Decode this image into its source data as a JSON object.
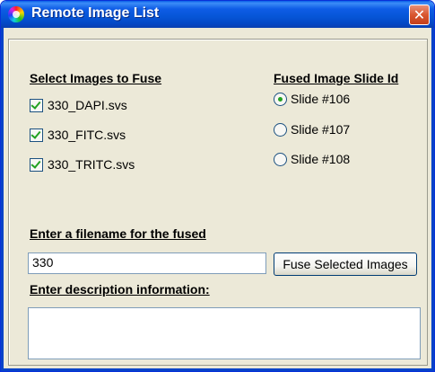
{
  "window": {
    "title": "Remote Image List",
    "close_glyph": "✕"
  },
  "select_section": {
    "heading": "Select Images to Fuse",
    "images": [
      {
        "label": "330_DAPI.svs",
        "checked": true
      },
      {
        "label": "330_FITC.svs",
        "checked": true
      },
      {
        "label": "330_TRITC.svs",
        "checked": true
      }
    ]
  },
  "slide_section": {
    "heading": "Fused Image Slide Id",
    "slides": [
      {
        "label": "Slide #106",
        "selected": true
      },
      {
        "label": "Slide #107",
        "selected": false
      },
      {
        "label": "Slide #108",
        "selected": false
      }
    ]
  },
  "filename_section": {
    "heading": "Enter a filename for the fused",
    "value": "330",
    "fuse_button": "Fuse Selected Images"
  },
  "description_section": {
    "heading": "Enter description information:",
    "value": ""
  },
  "colors": {
    "titlebar": "#0655d6",
    "background": "#ece9d8",
    "check_green": "#21a121"
  }
}
